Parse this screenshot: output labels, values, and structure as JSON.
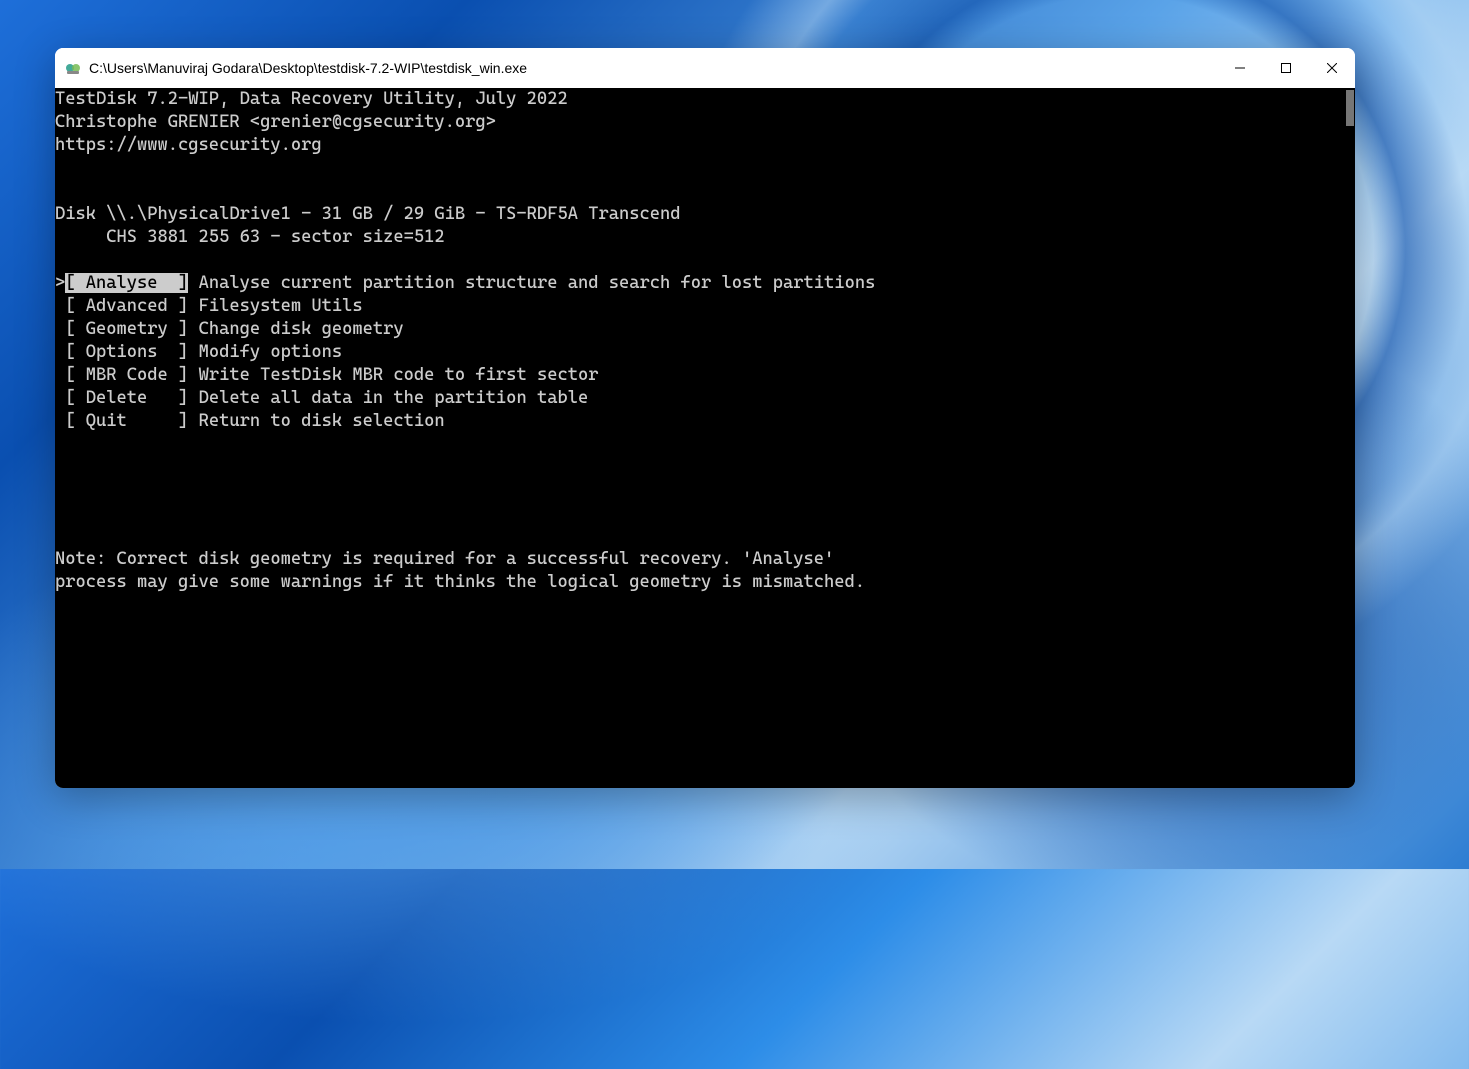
{
  "window": {
    "title": "C:\\Users\\Manuviraj Godara\\Desktop\\testdisk-7.2-WIP\\testdisk_win.exe"
  },
  "header": {
    "line1": "TestDisk 7.2-WIP, Data Recovery Utility, July 2022",
    "line2": "Christophe GRENIER <grenier@cgsecurity.org>",
    "line3": "https://www.cgsecurity.org"
  },
  "disk": {
    "line1": "Disk \\\\.\\PhysicalDrive1 - 31 GB / 29 GiB - TS-RDF5A Transcend",
    "line2": "     CHS 3881 255 63 - sector size=512"
  },
  "menu": {
    "cursor": ">",
    "items": [
      {
        "label": "[ Analyse  ]",
        "desc": " Analyse current partition structure and search for lost partitions",
        "selected": true
      },
      {
        "label": " [ Advanced ]",
        "desc": " Filesystem Utils",
        "selected": false
      },
      {
        "label": " [ Geometry ]",
        "desc": " Change disk geometry",
        "selected": false
      },
      {
        "label": " [ Options  ]",
        "desc": " Modify options",
        "selected": false
      },
      {
        "label": " [ MBR Code ]",
        "desc": " Write TestDisk MBR code to first sector",
        "selected": false
      },
      {
        "label": " [ Delete   ]",
        "desc": " Delete all data in the partition table",
        "selected": false
      },
      {
        "label": " [ Quit     ]",
        "desc": " Return to disk selection",
        "selected": false
      }
    ]
  },
  "note": {
    "line1": "Note: Correct disk geometry is required for a successful recovery. 'Analyse'",
    "line2": "process may give some warnings if it thinks the logical geometry is mismatched."
  }
}
